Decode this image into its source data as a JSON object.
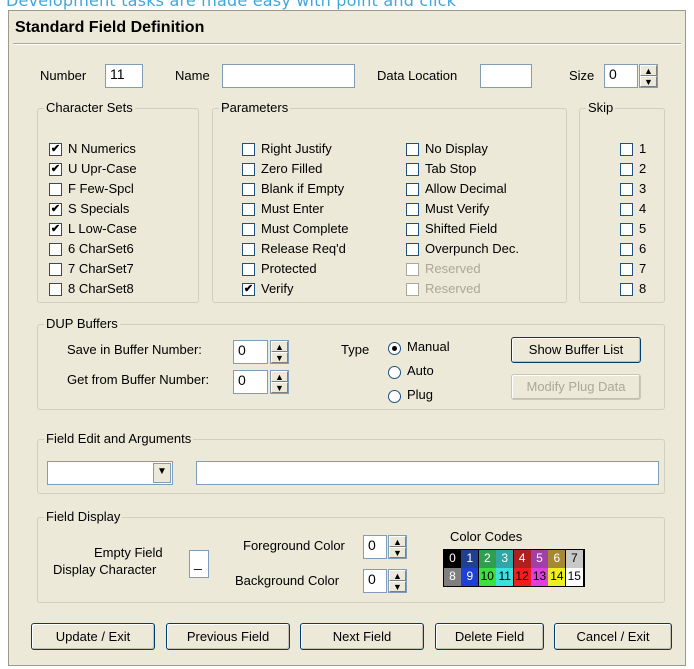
{
  "caption": "Development tasks are made easy with point and click",
  "dialog_title": "Standard Field Definition",
  "top_row": {
    "number_label": "Number",
    "number_value": "11",
    "name_label": "Name",
    "name_value": "",
    "data_location_label": "Data Location",
    "data_location_value": "",
    "size_label": "Size",
    "size_value": "0"
  },
  "character_sets": {
    "title": "Character Sets",
    "items": [
      {
        "label": "N  Numerics",
        "checked": true
      },
      {
        "label": "U  Upr-Case",
        "checked": true
      },
      {
        "label": "F  Few-Spcl",
        "checked": false
      },
      {
        "label": "S  Specials",
        "checked": true
      },
      {
        "label": "L  Low-Case",
        "checked": true
      },
      {
        "label": "6  CharSet6",
        "checked": false
      },
      {
        "label": "7  CharSet7",
        "checked": false
      },
      {
        "label": "8  CharSet8",
        "checked": false
      }
    ]
  },
  "parameters": {
    "title": "Parameters",
    "col1": [
      {
        "label": "Right Justify",
        "checked": false
      },
      {
        "label": "Zero Filled",
        "checked": false
      },
      {
        "label": "Blank if Empty",
        "checked": false
      },
      {
        "label": "Must Enter",
        "checked": false
      },
      {
        "label": "Must Complete",
        "checked": false
      },
      {
        "label": "Release Req'd",
        "checked": false
      },
      {
        "label": "Protected",
        "checked": false
      },
      {
        "label": "Verify",
        "checked": true
      }
    ],
    "col2": [
      {
        "label": "No Display",
        "checked": false
      },
      {
        "label": "Tab Stop",
        "checked": false
      },
      {
        "label": "Allow Decimal",
        "checked": false
      },
      {
        "label": "Must Verify",
        "checked": false
      },
      {
        "label": "Shifted Field",
        "checked": false
      },
      {
        "label": "Overpunch Dec.",
        "checked": false
      },
      {
        "label": "Reserved",
        "checked": false,
        "disabled": true
      },
      {
        "label": "Reserved",
        "checked": false,
        "disabled": true
      }
    ]
  },
  "skip": {
    "title": "Skip",
    "items": [
      "1",
      "2",
      "3",
      "4",
      "5",
      "6",
      "7",
      "8"
    ]
  },
  "dup_buffers": {
    "title": "DUP Buffers",
    "save_label": "Save in Buffer Number:",
    "save_value": "0",
    "get_label": "Get from Buffer Number:",
    "get_value": "0",
    "type_label": "Type",
    "radios": [
      {
        "label": "Manual",
        "selected": true
      },
      {
        "label": "Auto",
        "selected": false
      },
      {
        "label": "Plug",
        "selected": false
      }
    ],
    "show_button": "Show Buffer List",
    "modify_button": "Modify Plug Data"
  },
  "field_edit": {
    "title": "Field Edit and Arguments",
    "combo_value": "",
    "args_value": ""
  },
  "field_display": {
    "title": "Field Display",
    "empty_label_1": "Empty Field",
    "empty_label_2": "Display Character",
    "empty_value": "_",
    "fg_label": "Foreground Color",
    "fg_value": "0",
    "bg_label": "Background Color",
    "bg_value": "0",
    "color_codes_title": "Color Codes",
    "colors": [
      {
        "code": "0",
        "bg": "#000000",
        "fg": "#ffffff"
      },
      {
        "code": "1",
        "bg": "#1f3f8f",
        "fg": "#ffffff"
      },
      {
        "code": "2",
        "bg": "#2f9f4f",
        "fg": "#ffffff"
      },
      {
        "code": "3",
        "bg": "#2fa7a7",
        "fg": "#ffffff"
      },
      {
        "code": "4",
        "bg": "#b01f1f",
        "fg": "#ffffff"
      },
      {
        "code": "5",
        "bg": "#9f3fa7",
        "fg": "#ffffff"
      },
      {
        "code": "6",
        "bg": "#a7872f",
        "fg": "#ffffff"
      },
      {
        "code": "7",
        "bg": "#c8c8c8",
        "fg": "#000000"
      },
      {
        "code": "8",
        "bg": "#7f7f7f",
        "fg": "#ffffff"
      },
      {
        "code": "9",
        "bg": "#1f3fd7",
        "fg": "#ffffff"
      },
      {
        "code": "10",
        "bg": "#3fdf3f",
        "fg": "#000000"
      },
      {
        "code": "11",
        "bg": "#3fdfdf",
        "fg": "#000000"
      },
      {
        "code": "12",
        "bg": "#ef1f1f",
        "fg": "#000000"
      },
      {
        "code": "13",
        "bg": "#df3fdf",
        "fg": "#000000"
      },
      {
        "code": "14",
        "bg": "#efef1f",
        "fg": "#000000"
      },
      {
        "code": "15",
        "bg": "#ffffff",
        "fg": "#000000"
      }
    ]
  },
  "buttons": {
    "update_exit": "Update / Exit",
    "previous_field": "Previous Field",
    "next_field": "Next Field",
    "delete_field": "Delete Field",
    "cancel_exit": "Cancel / Exit"
  }
}
